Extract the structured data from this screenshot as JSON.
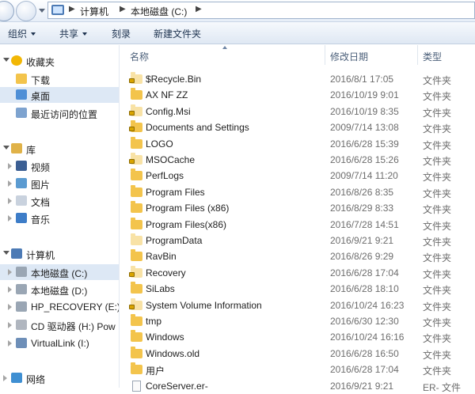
{
  "address": {
    "crumbs": [
      "计算机",
      "本地磁盘 (C:)"
    ]
  },
  "toolbar": {
    "organize": "组织",
    "share": "共享",
    "burn": "刻录",
    "new_folder": "新建文件夹"
  },
  "nav": {
    "items": [
      {
        "label": "收藏夹",
        "icon": "star-icon",
        "level": 0,
        "expand": "open",
        "selected": false
      },
      {
        "label": "下载",
        "icon": "download-folder-icon",
        "level": 1,
        "expand": "none",
        "selected": false
      },
      {
        "label": "桌面",
        "icon": "desktop-icon",
        "level": 1,
        "expand": "none",
        "selected": true
      },
      {
        "label": "最近访问的位置",
        "icon": "recent-places-icon",
        "level": 1,
        "expand": "none",
        "selected": false
      },
      {
        "label": "库",
        "icon": "library-icon",
        "level": 0,
        "expand": "open",
        "selected": false
      },
      {
        "label": "视频",
        "icon": "videos-icon",
        "level": 1,
        "expand": "closed",
        "selected": false
      },
      {
        "label": "图片",
        "icon": "pictures-icon",
        "level": 1,
        "expand": "closed",
        "selected": false
      },
      {
        "label": "文档",
        "icon": "documents-icon",
        "level": 1,
        "expand": "closed",
        "selected": false
      },
      {
        "label": "音乐",
        "icon": "music-icon",
        "level": 1,
        "expand": "closed",
        "selected": false
      },
      {
        "label": "计算机",
        "icon": "computer-icon",
        "level": 0,
        "expand": "open",
        "selected": false
      },
      {
        "label": "本地磁盘 (C:)",
        "icon": "drive-icon",
        "level": 1,
        "expand": "closed",
        "selected": true
      },
      {
        "label": "本地磁盘 (D:)",
        "icon": "drive-icon",
        "level": 1,
        "expand": "closed",
        "selected": false
      },
      {
        "label": "HP_RECOVERY (E:)",
        "icon": "drive-icon",
        "level": 1,
        "expand": "closed",
        "selected": false
      },
      {
        "label": "CD 驱动器 (H:) Pow",
        "icon": "cd-drive-icon",
        "level": 1,
        "expand": "closed",
        "selected": false
      },
      {
        "label": "VirtualLink (I:)",
        "icon": "network-drive-icon",
        "level": 1,
        "expand": "closed",
        "selected": false
      },
      {
        "label": "网络",
        "icon": "network-icon",
        "level": 0,
        "expand": "closed",
        "selected": false
      }
    ]
  },
  "columns": {
    "name": "名称",
    "date": "修改日期",
    "type": "类型"
  },
  "files": [
    {
      "name": "$Recycle.Bin",
      "date": "2016/8/1 17:05",
      "type": "文件夹",
      "icon": "folder-locked",
      "faded": true
    },
    {
      "name": "AX NF ZZ",
      "date": "2016/10/19 9:01",
      "type": "文件夹",
      "icon": "folder",
      "faded": false
    },
    {
      "name": "Config.Msi",
      "date": "2016/10/19 8:35",
      "type": "文件夹",
      "icon": "folder-locked",
      "faded": true
    },
    {
      "name": "Documents and Settings",
      "date": "2009/7/14 13:08",
      "type": "文件夹",
      "icon": "folder-locked",
      "faded": false
    },
    {
      "name": "LOGO",
      "date": "2016/6/28 15:39",
      "type": "文件夹",
      "icon": "folder",
      "faded": false
    },
    {
      "name": "MSOCache",
      "date": "2016/6/28 15:26",
      "type": "文件夹",
      "icon": "folder-locked",
      "faded": true
    },
    {
      "name": "PerfLogs",
      "date": "2009/7/14 11:20",
      "type": "文件夹",
      "icon": "folder",
      "faded": false
    },
    {
      "name": "Program Files",
      "date": "2016/8/26 8:35",
      "type": "文件夹",
      "icon": "folder",
      "faded": false
    },
    {
      "name": "Program Files (x86)",
      "date": "2016/8/29 8:33",
      "type": "文件夹",
      "icon": "folder",
      "faded": false
    },
    {
      "name": "Program Files(x86)",
      "date": "2016/7/28 14:51",
      "type": "文件夹",
      "icon": "folder",
      "faded": false
    },
    {
      "name": "ProgramData",
      "date": "2016/9/21 9:21",
      "type": "文件夹",
      "icon": "folder",
      "faded": true
    },
    {
      "name": "RavBin",
      "date": "2016/8/26 9:29",
      "type": "文件夹",
      "icon": "folder",
      "faded": false
    },
    {
      "name": "Recovery",
      "date": "2016/6/28 17:04",
      "type": "文件夹",
      "icon": "folder-locked",
      "faded": true
    },
    {
      "name": "SiLabs",
      "date": "2016/6/28 18:10",
      "type": "文件夹",
      "icon": "folder",
      "faded": false
    },
    {
      "name": "System Volume Information",
      "date": "2016/10/24 16:23",
      "type": "文件夹",
      "icon": "folder-locked",
      "faded": true
    },
    {
      "name": "tmp",
      "date": "2016/6/30 12:30",
      "type": "文件夹",
      "icon": "folder",
      "faded": false
    },
    {
      "name": "Windows",
      "date": "2016/10/24 16:16",
      "type": "文件夹",
      "icon": "folder",
      "faded": false
    },
    {
      "name": "Windows.old",
      "date": "2016/6/28 16:50",
      "type": "文件夹",
      "icon": "folder",
      "faded": false
    },
    {
      "name": "用户",
      "date": "2016/6/28 17:04",
      "type": "文件夹",
      "icon": "folder",
      "faded": false
    },
    {
      "name": "CoreServer.er-",
      "date": "2016/9/21 9:21",
      "type": "ER- 文件",
      "icon": "document",
      "faded": false
    }
  ],
  "colors": {
    "folder": "#f3c44c",
    "folder_faded": "#f8e2a6",
    "selection": "#dde8f5",
    "toolbar_text": "#1e3350"
  }
}
